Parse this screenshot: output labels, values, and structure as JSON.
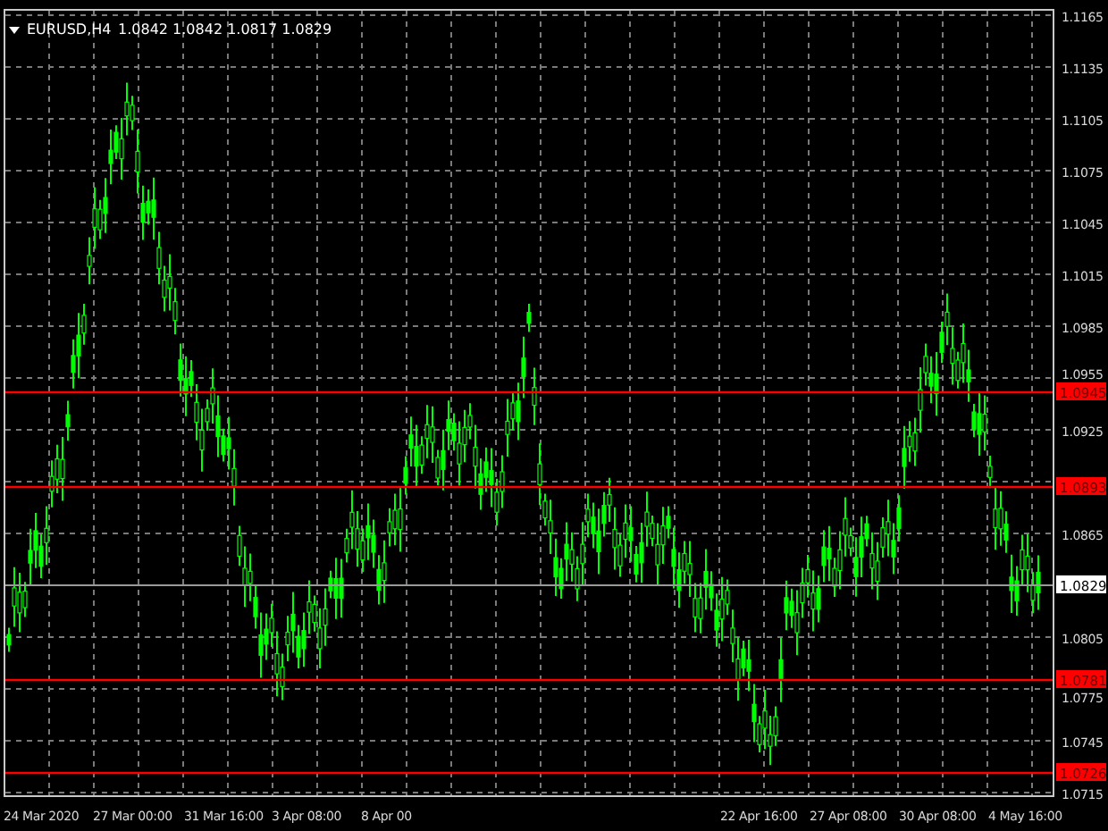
{
  "header": {
    "symbol": "EURUSD,H4",
    "ohlc": "1.0842 1.0842 1.0817 1.0829"
  },
  "price_axis": {
    "labels": [
      "1.1165",
      "1.1135",
      "1.1105",
      "1.1075",
      "1.1045",
      "1.1015",
      "1.0985",
      "1.0955",
      "1.0925",
      "1.0865",
      "1.0805",
      "1.0775",
      "1.0745",
      "1.0715"
    ]
  },
  "levels": [
    {
      "price_label": "1.0945"
    },
    {
      "price_label": "1.0893"
    },
    {
      "price_label": "1.0781"
    },
    {
      "price_label": "1.0726"
    }
  ],
  "current_price": "1.0829",
  "time_axis": {
    "labels": [
      "24 Mar 2020",
      "27 Mar 00:00",
      "31 Mar 16:00",
      "3 Apr 08:00",
      "8 Apr 00",
      "22 Apr 16:00",
      "27 Apr 08:00",
      "30 Apr 08:00",
      "4 May 16:00"
    ]
  }
}
